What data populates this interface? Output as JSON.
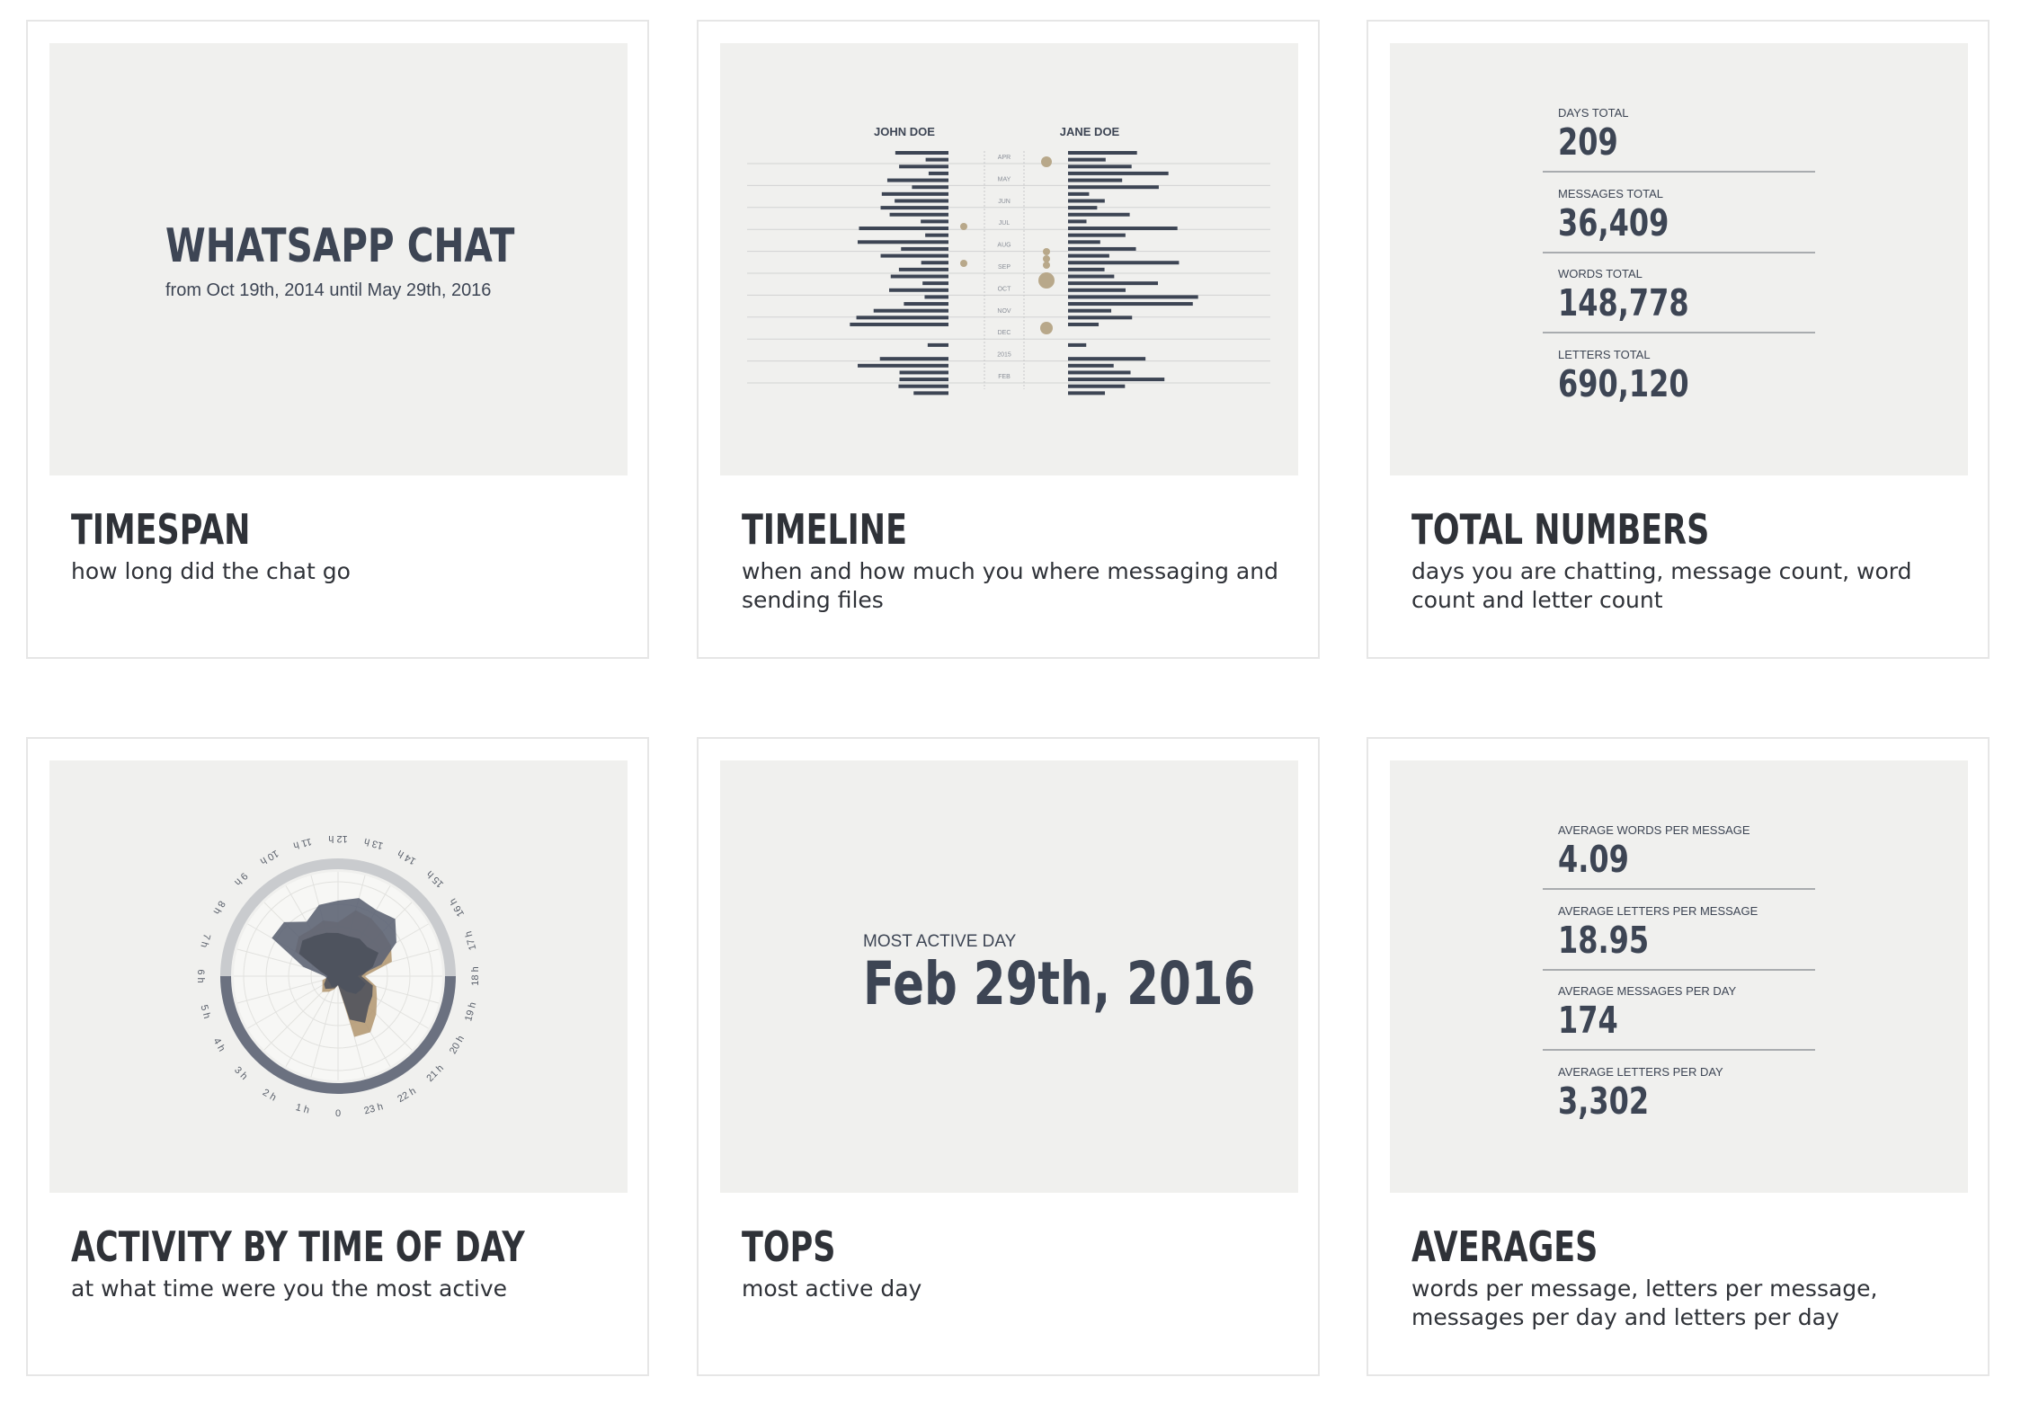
{
  "cards": [
    {
      "title": "TIMESPAN",
      "description": "how long did the chat go",
      "preview": {
        "heading": "WHATSAPP CHAT",
        "subheading": "from Oct 19th, 2014 until May 29th, 2016"
      }
    },
    {
      "title": "TIMELINE",
      "description": "when and how much you where messaging and sending files",
      "preview": {
        "left_name": "JOHN DOE",
        "right_name": "JANE DOE",
        "months": [
          "APR",
          "MAY",
          "JUN",
          "JUL",
          "AUG",
          "SEP",
          "OCT",
          "NOV",
          "DEC",
          "2015",
          "FEB"
        ]
      }
    },
    {
      "title": "TOTAL NUMBERS",
      "description": "days you are chatting, message count, word count and letter count",
      "preview": {
        "stats": [
          {
            "label": "DAYS TOTAL",
            "value": "209"
          },
          {
            "label": "MESSAGES TOTAL",
            "value": "36,409"
          },
          {
            "label": "WORDS TOTAL",
            "value": "148,778"
          },
          {
            "label": "LETTERS TOTAL",
            "value": "690,120"
          }
        ]
      }
    },
    {
      "title": "ACTIVITY BY TIME OF DAY",
      "description": "at what time were you the most active",
      "preview": {
        "hours": [
          "0",
          "1 h",
          "2 h",
          "3 h",
          "4 h",
          "5 h",
          "6 h",
          "7 h",
          "8 h",
          "9 h",
          "10 h",
          "11 h",
          "12 h",
          "13 h",
          "14 h",
          "15 h",
          "16 h",
          "17 h",
          "18 h",
          "19 h",
          "20 h",
          "21 h",
          "22 h",
          "23 h"
        ]
      }
    },
    {
      "title": "TOPS",
      "description": "most active day",
      "preview": {
        "label": "MOST ACTIVE DAY",
        "value": "Feb 29th, 2016"
      }
    },
    {
      "title": "AVERAGES",
      "description": "words per message, letters per message, messages per day and letters per day",
      "preview": {
        "stats": [
          {
            "label": "AVERAGE WORDS PER MESSAGE",
            "value": "4.09"
          },
          {
            "label": "AVERAGE LETTERS PER MESSAGE",
            "value": "18.95"
          },
          {
            "label": "AVERAGE MESSAGES PER DAY",
            "value": "174"
          },
          {
            "label": "AVERAGE LETTERS PER DAY",
            "value": "3,302"
          }
        ]
      }
    }
  ],
  "colors": {
    "ink": "#3d4554",
    "preview_bg": "#f0f0ee",
    "accent_tan": "#b8a88a",
    "ring_light": "#c9cbce",
    "ring_dark": "#6b7180"
  }
}
